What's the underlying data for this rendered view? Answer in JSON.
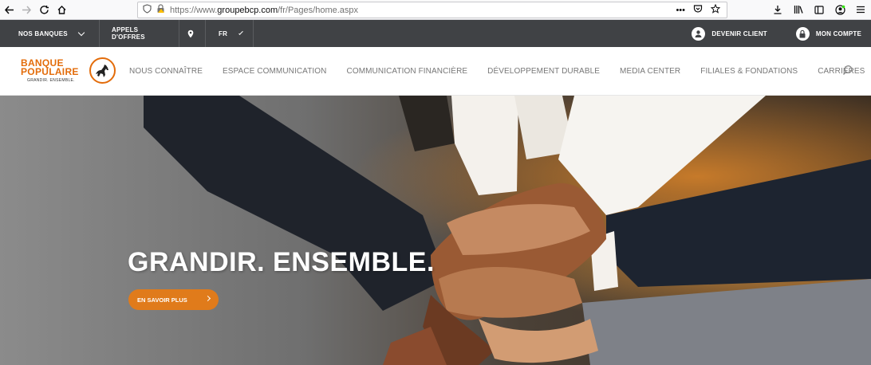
{
  "browser": {
    "url_prefix": "https://www.",
    "url_domain": "groupebcp.com",
    "url_path": "/fr/Pages/home.aspx",
    "page_actions": "•••"
  },
  "topbar": {
    "nos_banques": "NOS BANQUES",
    "appels": "APPELS D'OFFRES",
    "lang": "FR",
    "devenir_client": "DEVENIR CLIENT",
    "mon_compte": "MON COMPTE"
  },
  "logo": {
    "line1": "BANQUE",
    "line2": "POPULAIRE",
    "tagline": "GRANDIR. ENSEMBLE."
  },
  "nav": {
    "items": [
      "NOUS CONNAÎTRE",
      "ESPACE COMMUNICATION",
      "COMMUNICATION FINANCIÈRE",
      "DÉVELOPPEMENT DURABLE",
      "MEDIA CENTER",
      "FILIALES & FONDATIONS",
      "CARRIÈRES"
    ]
  },
  "hero": {
    "title": "GRANDIR. ENSEMBLE.",
    "cta": "EN SAVOIR PLUS"
  },
  "colors": {
    "brand_orange": "#e36c0a",
    "topbar_bg": "#404245",
    "cta_bg": "#e07b1b"
  }
}
